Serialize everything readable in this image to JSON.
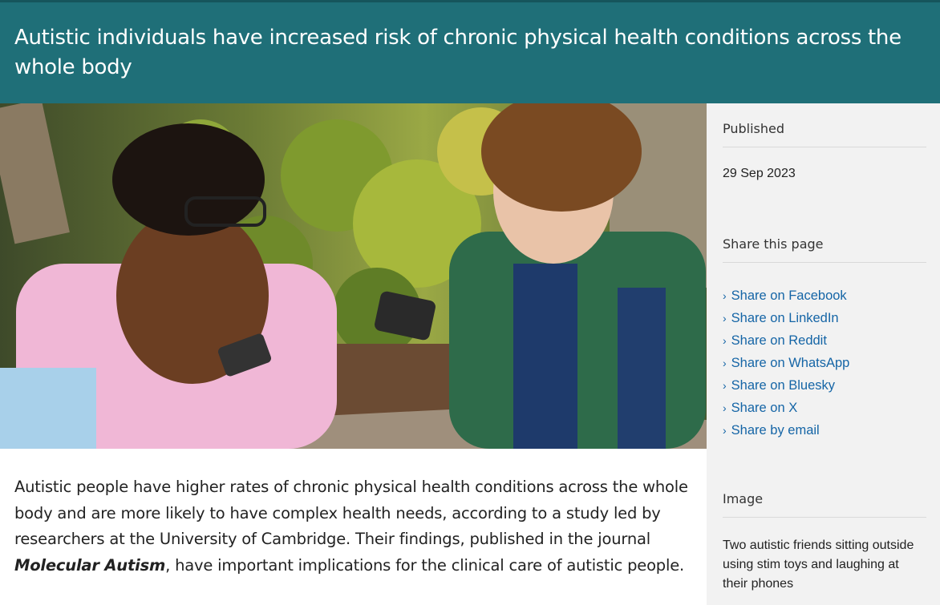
{
  "header": {
    "title": "Autistic individuals have increased risk of chronic physical health conditions across the whole body"
  },
  "article": {
    "lead_before": "Autistic people have higher rates of chronic physical health conditions across the whole body and are more likely to have complex health needs, according to a study led by researchers at the University of Cambridge. Their findings, published in the journal ",
    "lead_journal": "Molecular Autism",
    "lead_after": ", have important implications for the clinical care of autistic people."
  },
  "sidebar": {
    "published_label": "Published",
    "published_date": "29 Sep 2023",
    "share_label": "Share this page",
    "share_items": [
      {
        "label": "Share on Facebook"
      },
      {
        "label": "Share on LinkedIn"
      },
      {
        "label": "Share on Reddit"
      },
      {
        "label": "Share on WhatsApp"
      },
      {
        "label": "Share on Bluesky"
      },
      {
        "label": "Share on X"
      },
      {
        "label": "Share by email"
      }
    ],
    "image_label": "Image",
    "image_caption": "Two autistic friends sitting outside using stim toys and laughing at their phones"
  },
  "colors": {
    "header_bg": "#1f6f78",
    "link": "#1565a6",
    "sidebar_bg": "#f2f2f2"
  },
  "icons": {
    "share_bullet": "chevron-right-icon"
  }
}
